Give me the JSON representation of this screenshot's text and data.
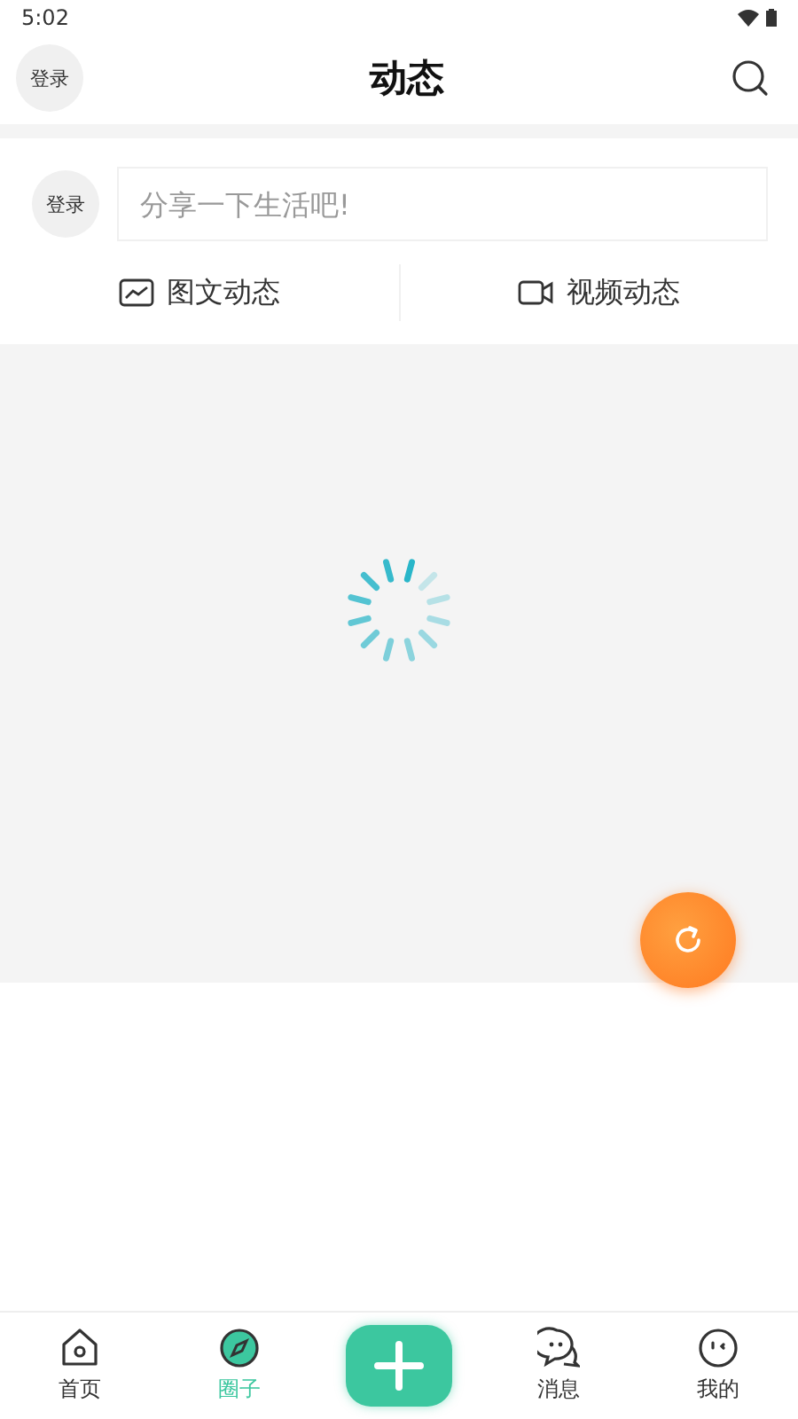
{
  "status_bar": {
    "time": "5:02"
  },
  "header": {
    "login": "登录",
    "title": "动态"
  },
  "composer": {
    "login": "登录",
    "placeholder": "分享一下生活吧!"
  },
  "post_types": [
    {
      "label": "图文动态"
    },
    {
      "label": "视频动态"
    }
  ],
  "tab_bar": [
    {
      "kind": "tab",
      "label": "首页",
      "selected": false
    },
    {
      "kind": "tab",
      "label": "圈子",
      "selected": true
    },
    {
      "kind": "add"
    },
    {
      "kind": "tab",
      "label": "消息",
      "selected": false
    },
    {
      "kind": "tab",
      "label": "我的",
      "selected": false
    }
  ]
}
